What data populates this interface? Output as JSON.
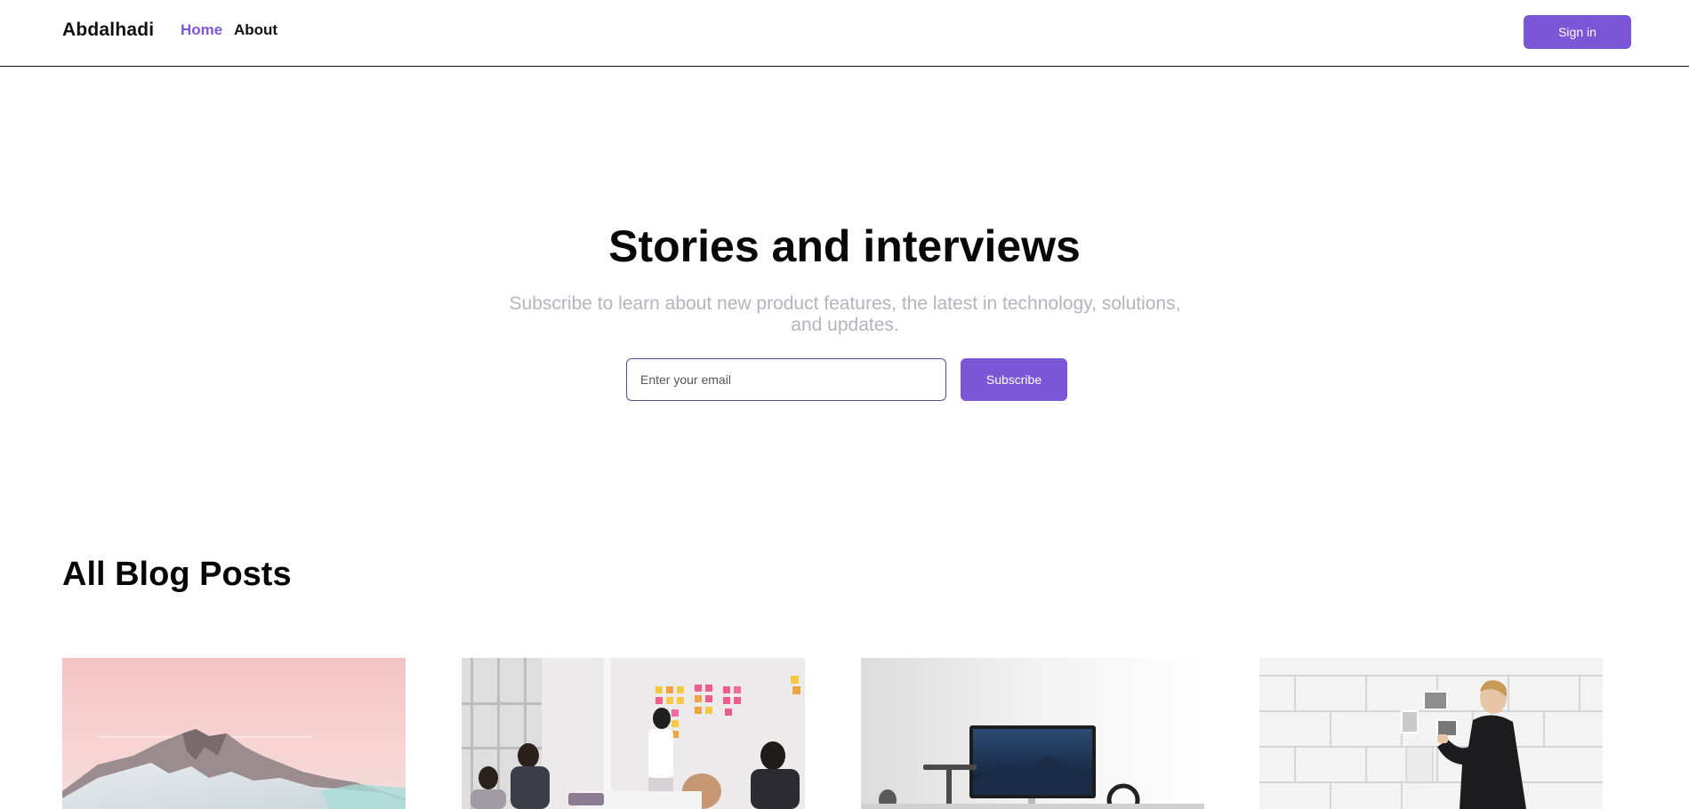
{
  "nav": {
    "brand": "Abdalhadi",
    "links": [
      {
        "label": "Home",
        "active": true
      },
      {
        "label": "About",
        "active": false
      }
    ],
    "signin_label": "Sign in"
  },
  "hero": {
    "title": "Stories and interviews",
    "subtitle": "Subscribe to learn about new product features, the latest in technology, solutions, and updates.",
    "email_placeholder": "Enter your email",
    "subscribe_label": "Subscribe"
  },
  "posts": {
    "section_title": "All Blog Posts",
    "cards": [
      {
        "image": "snowy-mountain-pink-sky-photo"
      },
      {
        "image": "team-meeting-sticky-notes-photo"
      },
      {
        "image": "desk-monitor-workspace-photo"
      },
      {
        "image": "man-pinning-photos-wall-photo"
      }
    ]
  },
  "colors": {
    "accent": "#7b57d7",
    "active_link": "#7e57d9",
    "subtitle": "#b4b4bd"
  }
}
